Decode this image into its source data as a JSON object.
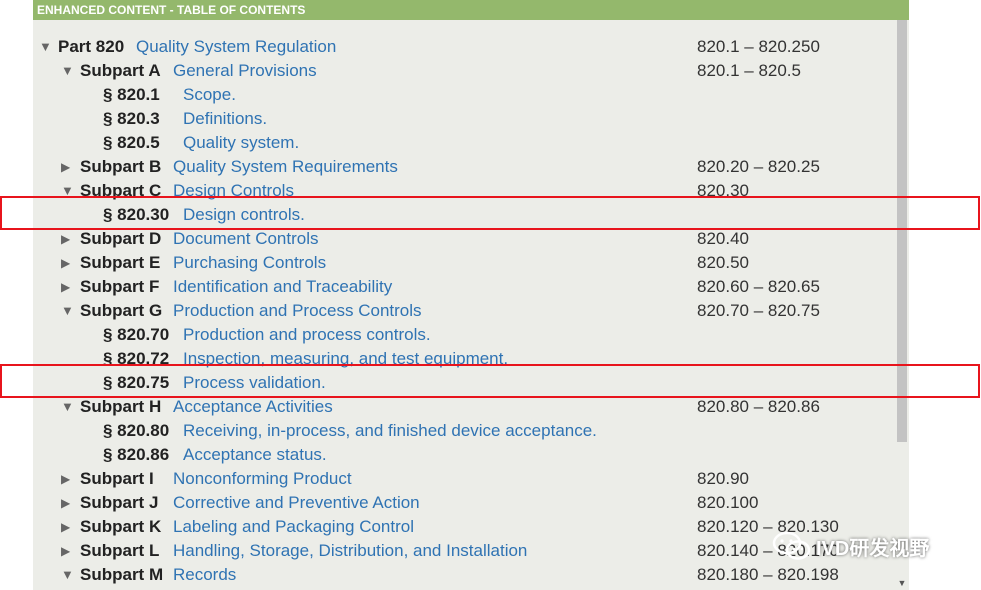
{
  "header": {
    "title": "ENHANCED CONTENT - TABLE OF CONTENTS"
  },
  "toc": [
    {
      "level": 0,
      "toggle": "expanded",
      "key": "Part 820",
      "title": "Quality System Regulation",
      "range": "820.1 – 820.250"
    },
    {
      "level": 1,
      "toggle": "expanded",
      "key": "Subpart A",
      "title": "General Provisions",
      "range": "820.1 – 820.5"
    },
    {
      "level": 2,
      "toggle": "none",
      "key": "§ 820.1",
      "title": "Scope.",
      "range": ""
    },
    {
      "level": 2,
      "toggle": "none",
      "key": "§ 820.3",
      "title": "Definitions.",
      "range": ""
    },
    {
      "level": 2,
      "toggle": "none",
      "key": "§ 820.5",
      "title": "Quality system.",
      "range": ""
    },
    {
      "level": 1,
      "toggle": "collapsed",
      "key": "Subpart B",
      "title": "Quality System Requirements",
      "range": "820.20 – 820.25"
    },
    {
      "level": 1,
      "toggle": "expanded",
      "key": "Subpart C",
      "title": "Design Controls",
      "range": "820.30"
    },
    {
      "level": 2,
      "toggle": "none",
      "key": "§ 820.30",
      "title": "Design controls.",
      "range": ""
    },
    {
      "level": 1,
      "toggle": "collapsed",
      "key": "Subpart D",
      "title": "Document Controls",
      "range": "820.40"
    },
    {
      "level": 1,
      "toggle": "collapsed",
      "key": "Subpart E",
      "title": "Purchasing Controls",
      "range": "820.50"
    },
    {
      "level": 1,
      "toggle": "collapsed",
      "key": "Subpart F",
      "title": "Identification and Traceability",
      "range": "820.60 – 820.65"
    },
    {
      "level": 1,
      "toggle": "expanded",
      "key": "Subpart G",
      "title": "Production and Process Controls",
      "range": "820.70 – 820.75"
    },
    {
      "level": 2,
      "toggle": "none",
      "key": "§ 820.70",
      "title": "Production and process controls.",
      "range": ""
    },
    {
      "level": 2,
      "toggle": "none",
      "key": "§ 820.72",
      "title": "Inspection, measuring, and test equipment.",
      "range": ""
    },
    {
      "level": 2,
      "toggle": "none",
      "key": "§ 820.75",
      "title": "Process validation.",
      "range": ""
    },
    {
      "level": 1,
      "toggle": "expanded",
      "key": "Subpart H",
      "title": "Acceptance Activities",
      "range": "820.80 – 820.86"
    },
    {
      "level": 2,
      "toggle": "none",
      "key": "§ 820.80",
      "title": "Receiving, in-process, and finished device acceptance.",
      "range": ""
    },
    {
      "level": 2,
      "toggle": "none",
      "key": "§ 820.86",
      "title": "Acceptance status.",
      "range": ""
    },
    {
      "level": 1,
      "toggle": "collapsed",
      "key": "Subpart I",
      "title": "Nonconforming Product",
      "range": "820.90"
    },
    {
      "level": 1,
      "toggle": "collapsed",
      "key": "Subpart J",
      "title": "Corrective and Preventive Action",
      "range": "820.100"
    },
    {
      "level": 1,
      "toggle": "collapsed",
      "key": "Subpart K",
      "title": "Labeling and Packaging Control",
      "range": "820.120 – 820.130"
    },
    {
      "level": 1,
      "toggle": "collapsed",
      "key": "Subpart L",
      "title": "Handling, Storage, Distribution, and Installation",
      "range": "820.140 – 820.170"
    },
    {
      "level": 1,
      "toggle": "expanded",
      "key": "Subpart M",
      "title": "Records",
      "range": "820.180 – 820.198"
    }
  ],
  "highlighted_keys": [
    "§ 820.30",
    "§ 820.75"
  ],
  "watermark": {
    "text": "IVD研发视野"
  },
  "colors": {
    "header_bg": "#94b86c",
    "link": "#2f73b3",
    "panel_bg": "#ecede8",
    "highlight": "#e8141c"
  },
  "icons": {
    "expanded": "triangle-down-icon",
    "collapsed": "triangle-right-icon",
    "scroll_down": "scroll-down-arrow-icon"
  }
}
